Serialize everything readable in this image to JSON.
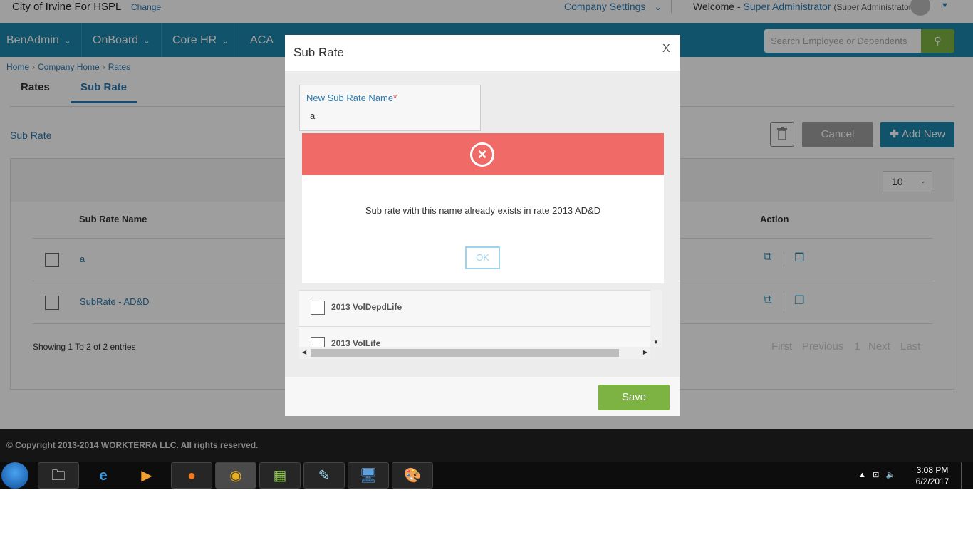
{
  "header": {
    "company": "City of Irvine For HSPL",
    "change_label": "Change",
    "company_settings": "Company Settings",
    "welcome_prefix": "Welcome -",
    "user_name": "Super Administrator",
    "user_role": "(Super Administrator)"
  },
  "nav": {
    "items": [
      "BenAdmin",
      "OnBoard",
      "Core HR",
      "ACA"
    ],
    "search_placeholder": "Search Employee or Dependents"
  },
  "breadcrumb": [
    "Home",
    "Company Home",
    "Rates"
  ],
  "tabs": [
    "Rates",
    "Sub Rate"
  ],
  "page": {
    "section_title": "Sub Rate",
    "cancel_label": "Cancel",
    "add_new_label": "Add New",
    "page_size": "10",
    "columns": {
      "name": "Sub Rate Name",
      "action": "Action"
    },
    "rows": [
      {
        "name": "a"
      },
      {
        "name": "SubRate - AD&D"
      }
    ],
    "showing": "Showing 1 To 2 of 2 entries",
    "pager": [
      "First",
      "Previous",
      "1",
      "Next",
      "Last"
    ]
  },
  "footer": {
    "copyright": "© Copyright 2013-2014 WORKTERRA LLC. All rights reserved."
  },
  "modal": {
    "title": "Sub Rate",
    "close": "X",
    "field_label": "New Sub Rate Name",
    "required_mark": "*",
    "field_value": "a",
    "rate_options": [
      "2013 VolDepdLife",
      "2013 VolLife"
    ],
    "save_label": "Save"
  },
  "error_dialog": {
    "message": "Sub rate with this name already exists in rate 2013 AD&D",
    "ok_label": "OK"
  },
  "taskbar": {
    "time": "3:08 PM",
    "date": "6/2/2017"
  },
  "colors": {
    "nav_bg": "#1c87ab",
    "accent_green": "#7cb342",
    "error_header": "#f06b67",
    "link_blue": "#2a7ab0"
  }
}
